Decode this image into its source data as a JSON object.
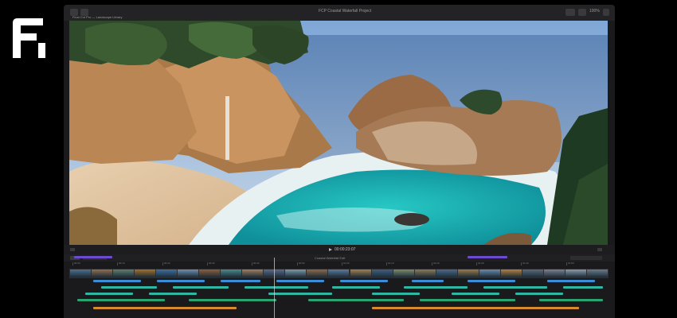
{
  "window": {
    "left_title": "Final Cut Pro — Landscape Library",
    "center_title": "FCP Coastal Waterfall Project",
    "right_value": "100%"
  },
  "brand": {
    "logo_icon": "brand-logo-f-icon",
    "colors": {
      "app_bg": "#1a1a1c",
      "timeline_purple": "#6c4bd1",
      "timeline_blue": "#3a8dd6",
      "timeline_teal": "#2fb7a3",
      "timeline_green": "#29a36f",
      "timeline_orange": "#d88b2c"
    }
  },
  "viewer": {
    "timecode": "00:00:23:07"
  },
  "timeline": {
    "project_label": "Coastal Waterfall Edit",
    "ruler_labels": [
      "00:00",
      "00:10",
      "00:20",
      "00:30",
      "00:40",
      "00:50",
      "01:00",
      "01:10",
      "01:20",
      "01:30",
      "01:40",
      "01:50"
    ],
    "clip_colors": [
      "#4f6f8f",
      "#8f6f4f",
      "#5f7f6f",
      "#a0702a",
      "#3f6fa0",
      "#6f8faf",
      "#8a5f3f",
      "#4a8a8a",
      "#9f7f5f",
      "#5a6a8a",
      "#7a9aaa",
      "#8a6a4a",
      "#5a7a9a",
      "#a08050",
      "#406080",
      "#7a8a6a",
      "#8a7a5a",
      "#4a6a8a",
      "#9a7a4a",
      "#6a8aaa",
      "#b08040",
      "#5a6a7a",
      "#7a8090",
      "#8a9aaa",
      "#6a7a8a"
    ]
  }
}
